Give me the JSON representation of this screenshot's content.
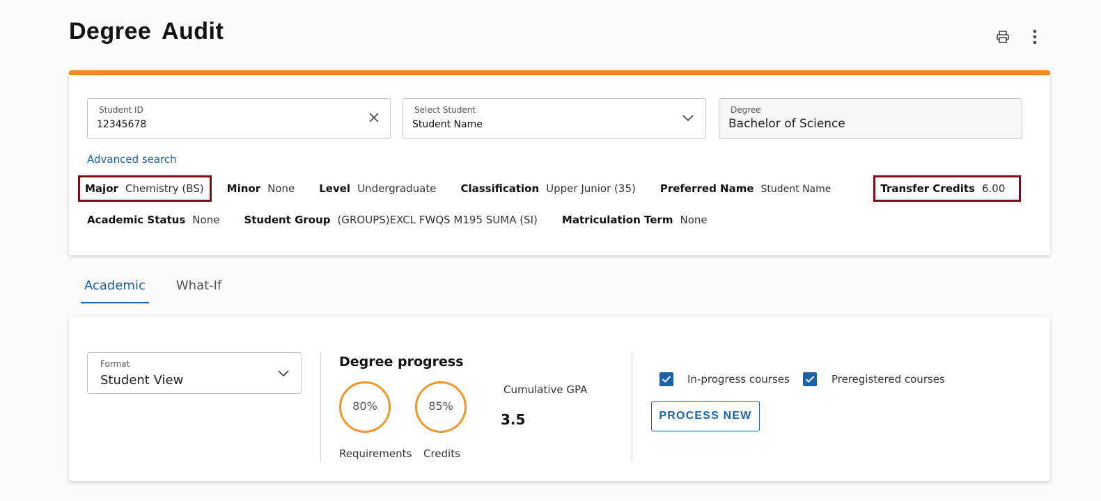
{
  "page": {
    "title": "Degree Audit"
  },
  "icons": {
    "print": "printer-icon",
    "more": "more-vertical-icon"
  },
  "colors": {
    "accent_bar": "#f6891f",
    "link": "#1a61a8",
    "highlight": "#7d0f1b"
  },
  "student_id": {
    "label": "Student ID",
    "value": "12345678"
  },
  "select_student": {
    "label": "Select Student",
    "value": "Student Name"
  },
  "degree": {
    "label": "Degree",
    "value": "Bachelor of Science"
  },
  "advanced_search": "Advanced search",
  "info": {
    "major": {
      "label": "Major",
      "value": "Chemistry (BS)"
    },
    "minor": {
      "label": "Minor",
      "value": "None"
    },
    "level": {
      "label": "Level",
      "value": "Undergraduate"
    },
    "classification": {
      "label": "Classification",
      "value": "Upper Junior (35)"
    },
    "preferred_name": {
      "label": "Preferred Name",
      "value": "Student Name"
    },
    "transfer_credits": {
      "label": "Transfer Credits",
      "value": "6.00"
    },
    "academic_status": {
      "label": "Academic Status",
      "value": "None"
    },
    "student_group": {
      "label": "Student Group",
      "value": "(GROUPS)EXCL FWQS M195 SUMA (SI)"
    },
    "matriculation_term": {
      "label": "Matriculation Term",
      "value": "None"
    }
  },
  "tabs": [
    {
      "label": "Academic",
      "active": true
    },
    {
      "label": "What-If",
      "active": false
    }
  ],
  "format": {
    "label": "Format",
    "value": "Student View"
  },
  "degree_progress": {
    "title": "Degree progress",
    "requirements": {
      "percent": 80,
      "text": "80%",
      "label": "Requirements"
    },
    "credits": {
      "percent": 85,
      "text": "85%",
      "label": "Credits"
    },
    "gpa": {
      "label": "Cumulative GPA",
      "value": "3.5"
    }
  },
  "options": {
    "in_progress": {
      "label": "In-progress courses",
      "checked": true
    },
    "preregistered": {
      "label": "Preregistered courses",
      "checked": true
    }
  },
  "process_new": "PROCESS NEW"
}
